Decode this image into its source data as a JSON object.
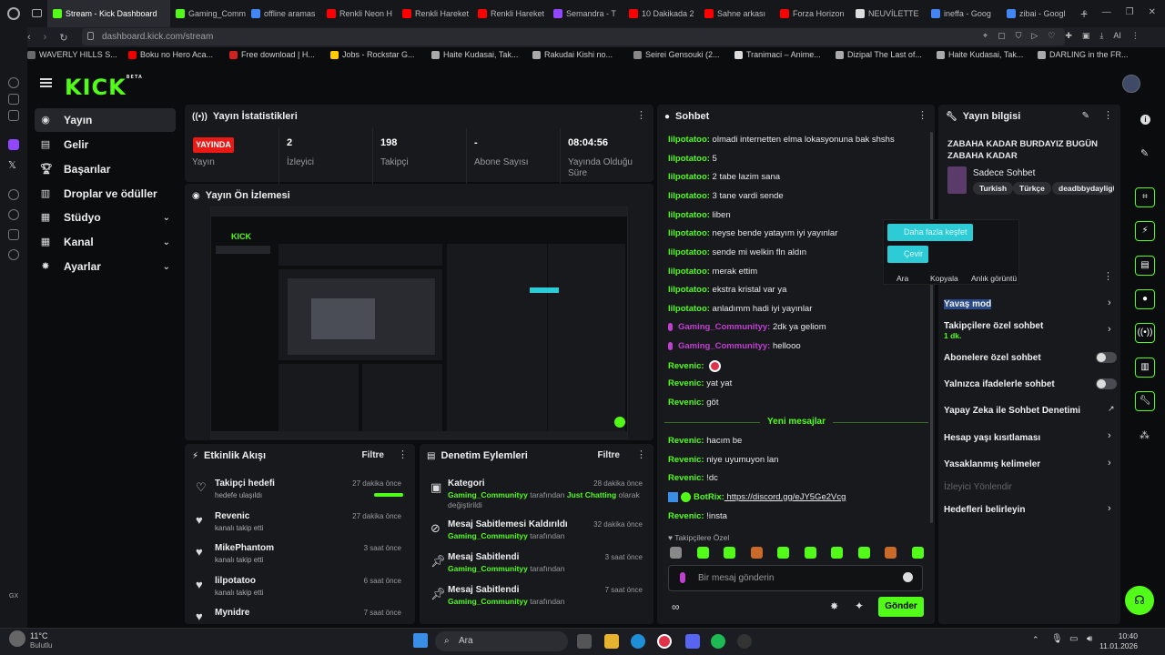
{
  "browser": {
    "tabs": [
      {
        "label": "Stream - Kick Dashboard",
        "color": "#53fc18",
        "active": true
      },
      {
        "label": "Gaming_Comm",
        "color": "#53fc18"
      },
      {
        "label": "offline aramas",
        "color": "#4285f4"
      },
      {
        "label": "Renkli Neon H",
        "color": "#ff0000"
      },
      {
        "label": "Renkli Hareket",
        "color": "#ff0000"
      },
      {
        "label": "Renkli Hareket",
        "color": "#ff0000"
      },
      {
        "label": "Semandra - T",
        "color": "#9146ff"
      },
      {
        "label": "10 Dakikada 2",
        "color": "#ff0000"
      },
      {
        "label": "Sahne arkası",
        "color": "#ff0000"
      },
      {
        "label": "Forza Horizon",
        "color": "#ff0000"
      },
      {
        "label": "NEUVİLETTE",
        "color": "#dddddd"
      },
      {
        "label": "ineffa - Goog",
        "color": "#4285f4"
      },
      {
        "label": "zibai - Googl",
        "color": "#4285f4"
      }
    ],
    "url": "dashboard.kick.com/stream",
    "bookmarks": [
      "WAVERLY HILLS S...",
      "Boku no Hero Aca...",
      "Free download | H...",
      "Jobs - Rockstar G...",
      "Haite Kudasai, Tak...",
      "Rakudai Kishi no...",
      "Seirei Gensouki (2...",
      "Tranimaci – Anime...",
      "Dizipal The Last of...",
      "Haite Kudasai, Tak...",
      "DARLING in the FR..."
    ]
  },
  "brand": {
    "logo": "KICK",
    "beta": "BETA",
    "accent": "#53fc18"
  },
  "nav": [
    {
      "label": "Yayın",
      "icon": "broadcast-icon"
    },
    {
      "label": "Gelir",
      "icon": "chart-icon"
    },
    {
      "label": "Başarılar",
      "icon": "trophy-icon"
    },
    {
      "label": "Droplar ve ödüller",
      "icon": "gift-icon"
    },
    {
      "label": "Stüdyo",
      "icon": "studio-icon"
    },
    {
      "label": "Kanal",
      "icon": "channel-icon"
    },
    {
      "label": "Ayarlar",
      "icon": "gear-icon"
    }
  ],
  "stats": {
    "title": "Yayın İstatistikleri",
    "live_badge": "YAYINDA",
    "items": [
      {
        "value": "",
        "label": "Yayın"
      },
      {
        "value": "2",
        "label": "İzleyici"
      },
      {
        "value": "198",
        "label": "Takipçi"
      },
      {
        "value": "-",
        "label": "Abone Sayısı"
      },
      {
        "value": "08:04:56",
        "label": "Yayında Olduğu Süre"
      }
    ]
  },
  "preview": {
    "title": "Yayın Ön İzlemesi"
  },
  "feed": {
    "title": "Etkinlik Akışı",
    "filter": "Filtre",
    "items": [
      {
        "title": "Takipçi hedefi",
        "sub": "hedefe ulaşıldı",
        "time": "27 dakika önce"
      },
      {
        "title": "Revenic",
        "sub": "kanalı takip etti",
        "time": "27 dakika önce"
      },
      {
        "title": "MikePhantom",
        "sub": "kanalı takip etti",
        "time": "3 saat önce"
      },
      {
        "title": "lilpotatoo",
        "sub": "kanalı takip etti",
        "time": "6 saat önce"
      },
      {
        "title": "Mynidre",
        "sub": "",
        "time": "7 saat önce"
      }
    ]
  },
  "moderation": {
    "title": "Denetim Eylemleri",
    "filter": "Filtre",
    "items": [
      {
        "title": "Kategori",
        "user": "Gaming_Communityy",
        "text": " tarafından ",
        "extra": "Just Chatting",
        "tail": " olarak değiştirildi",
        "time": "28 dakika önce"
      },
      {
        "title": "Mesaj Sabitlemesi Kaldırıldı",
        "user": "Gaming_Communityy",
        "text": " tarafından",
        "extra": "",
        "tail": "",
        "time": "32 dakika önce"
      },
      {
        "title": "Mesaj Sabitlendi",
        "user": "Gaming_Communityy",
        "text": " tarafından",
        "extra": "",
        "tail": "",
        "time": "3 saat önce"
      },
      {
        "title": "Mesaj Sabitlendi",
        "user": "Gaming_Communityy",
        "text": " tarafından",
        "extra": "",
        "tail": "",
        "time": "7 saat önce"
      }
    ]
  },
  "chat": {
    "title": "Sohbet",
    "messages": [
      {
        "user": "lilpotatoo:",
        "text": " olmadi internetten elma lokasyonuna bak shshs",
        "style": "u"
      },
      {
        "user": "lilpotatoo:",
        "text": " 5",
        "style": "u"
      },
      {
        "user": "lilpotatoo:",
        "text": " 2 tabe lazim sana",
        "style": "u"
      },
      {
        "user": "lilpotatoo:",
        "text": " 3 tane vardi sende",
        "style": "u"
      },
      {
        "user": "lilpotatoo:",
        "text": " liben",
        "style": "u"
      },
      {
        "user": "lilpotatoo:",
        "text": " neyse bende yatayım iyi yayınlar",
        "style": "u"
      },
      {
        "user": "lilpotatoo:",
        "text": " sende mi welkin fln aldın",
        "style": "u"
      },
      {
        "user": "lilpotatoo:",
        "text": " merak ettim",
        "style": "u"
      },
      {
        "user": "lilpotatoo:",
        "text": " ekstra kristal var ya",
        "style": "u"
      },
      {
        "user": "lilpotatoo:",
        "text": " anladımm hadi iyi yayınlar",
        "style": "u"
      },
      {
        "user": "Gaming_Communityy:",
        "text": " 2dk ya geliom",
        "style": "up"
      },
      {
        "user": "Gaming_Communityy:",
        "text": " hellooo",
        "style": "up"
      },
      {
        "user": "Revenic:",
        "text": "",
        "style": "u"
      },
      {
        "user": "Revenic:",
        "text": " yat yat",
        "style": "u"
      },
      {
        "user": "Revenic:",
        "text": " göt",
        "style": "u"
      }
    ],
    "new_divider": "Yeni mesajlar",
    "new_messages": [
      {
        "user": "Revenic:",
        "text": " hacım be"
      },
      {
        "user": "Revenic:",
        "text": " niye uyumuyon lan"
      },
      {
        "user": "Revenic:",
        "text": " !dc"
      },
      {
        "user": "BotRix:",
        "text": " https://discord.gg/eJY5Ge2Vcg"
      },
      {
        "user": "Revenic:",
        "text": " !insta"
      }
    ],
    "emote_section": "Takipçilere Özel",
    "input_placeholder": "Bir mesaj gönderin",
    "send_label": "Gönder"
  },
  "stream_info": {
    "title": "Yayın bilgisi",
    "stream_title": "ZABAHA KADAR BURDAYIZ BUGÜN ZABAHA KADAR",
    "category": "Sadece Sohbet",
    "tags": [
      "Turkish",
      "Türkçe",
      "deadbbydaylight"
    ]
  },
  "popup": {
    "btn1": "Daha fazla keşfet",
    "btn2": "Çevir",
    "opt1": "Ara",
    "opt2": "Kopyala",
    "opt3": "Anlık görüntü"
  },
  "chat_settings": {
    "slow": "Yavaş mod",
    "followers": "Takipçilere özel sohbet",
    "followers_sub": "1 dk.",
    "subs": "Abonelere özel sohbet",
    "emotes": "Yalnızca ifadelerle sohbet",
    "ai": "Yapay Zeka ile Sohbet Denetimi",
    "age": "Hesap yaşı kısıtlaması",
    "banned": "Yasaklanmış kelimeler",
    "viewer": "İzleyici Yönlendir",
    "goals": "Hedefleri belirleyin"
  },
  "taskbar": {
    "weather_temp": "11°C",
    "weather_desc": "Bulutlu",
    "search": "Ara",
    "time": "10:40",
    "date": "11.01.2026"
  }
}
